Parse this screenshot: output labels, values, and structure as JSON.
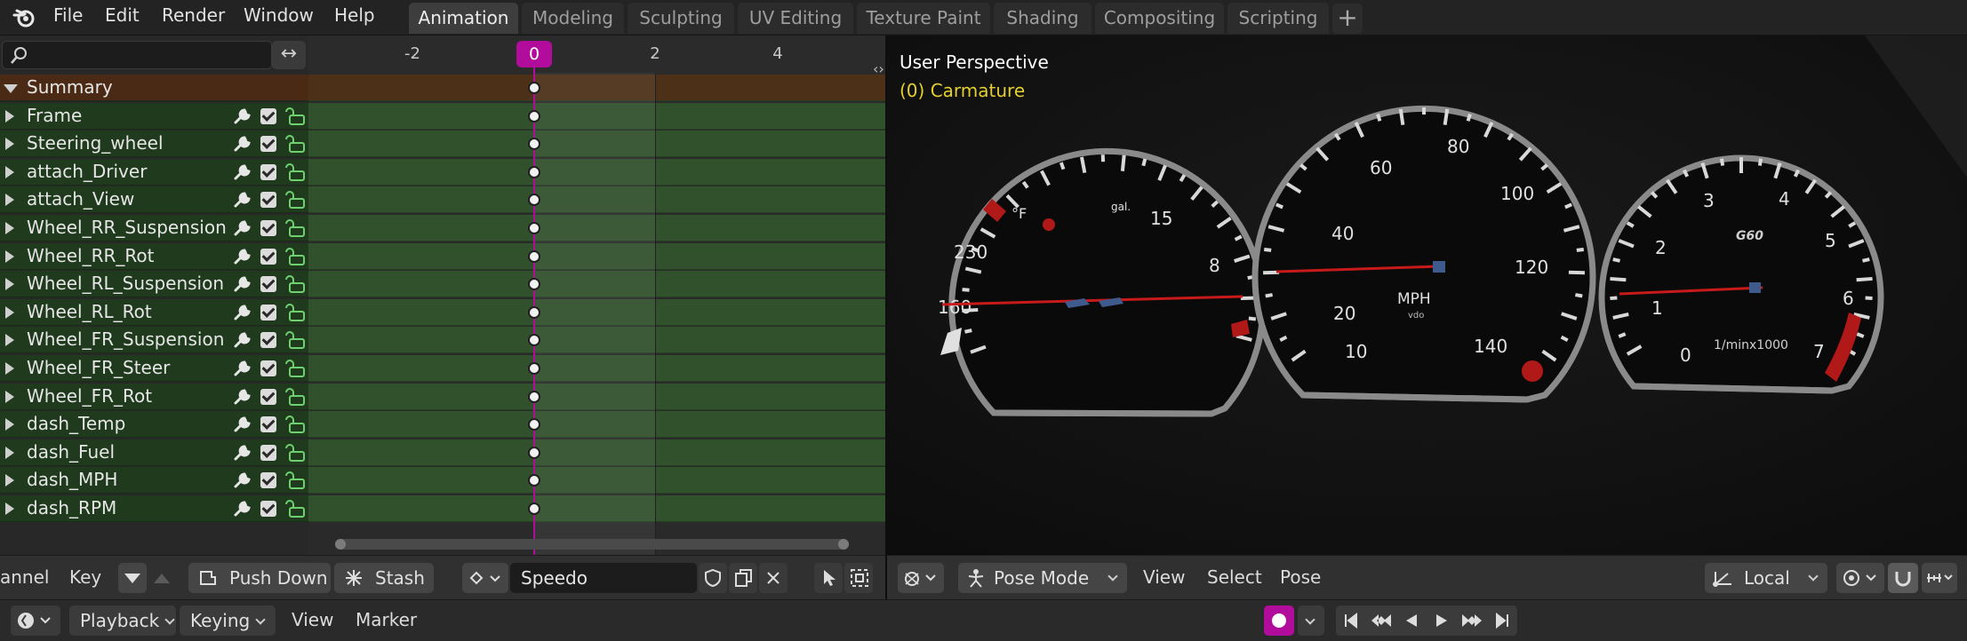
{
  "menu": [
    "File",
    "Edit",
    "Render",
    "Window",
    "Help"
  ],
  "workspaces": [
    {
      "label": "Animation",
      "active": true
    },
    {
      "label": "Modeling"
    },
    {
      "label": "Sculpting"
    },
    {
      "label": "UV Editing"
    },
    {
      "label": "Texture Paint"
    },
    {
      "label": "Shading"
    },
    {
      "label": "Compositing"
    },
    {
      "label": "Scripting"
    }
  ],
  "workspace_add": "+",
  "dopesheet": {
    "search": {
      "value": "",
      "placeholder": ""
    },
    "swap_icon": "↔",
    "ruler": {
      "ticks": [
        "-2",
        "0",
        "2",
        "4"
      ],
      "current_frame": "0"
    },
    "summary_label": "Summary",
    "channels": [
      "Frame",
      "Steering_wheel",
      "attach_Driver",
      "attach_View",
      "Wheel_RR_Suspension",
      "Wheel_RR_Rot",
      "Wheel_RL_Suspension",
      "Wheel_RL_Rot",
      "Wheel_FR_Suspension",
      "Wheel_FR_Steer",
      "Wheel_FR_Rot",
      "dash_Temp",
      "dash_Fuel",
      "dash_MPH",
      "dash_RPM"
    ],
    "header": {
      "channel_menu": "annel",
      "key_menu": "Key",
      "push_down": "Push Down",
      "stash": "Stash",
      "action_name": "Speedo"
    }
  },
  "viewport": {
    "title": "User Perspective",
    "object": "(0) Carmature",
    "header": {
      "mode": "Pose Mode",
      "menus": [
        "View",
        "Select",
        "Pose"
      ],
      "transform_orientation": "Local"
    },
    "gauges": {
      "left": {
        "labels": [
          "160",
          "230",
          "8",
          "15"
        ],
        "units": [
          "°F",
          "gal."
        ]
      },
      "center": {
        "labels": [
          "10",
          "20",
          "40",
          "60",
          "80",
          "100",
          "120",
          "140"
        ],
        "unit": "MPH",
        "brand": "vdo"
      },
      "right": {
        "labels": [
          "0",
          "1",
          "2",
          "3",
          "4",
          "5",
          "6",
          "7"
        ],
        "unit": "1/minx1000",
        "brand": "G60"
      }
    }
  },
  "timeline_bar": {
    "playback": "Playback",
    "keying": "Keying",
    "view": "View",
    "marker": "Marker"
  },
  "colors": {
    "playhead": "#b10c9c",
    "channel_bg": "#1f3a1c",
    "summary_bg": "#4a2a14",
    "object_text": "#e3cf2e"
  }
}
